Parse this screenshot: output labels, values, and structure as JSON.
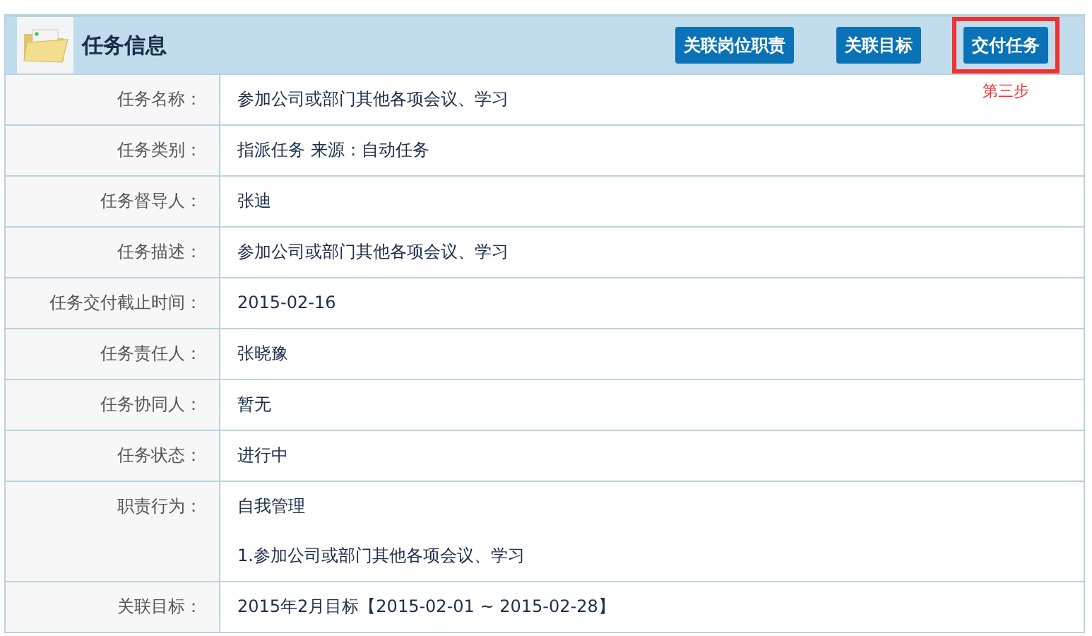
{
  "panel": {
    "title": "任务信息"
  },
  "buttons": [
    {
      "label": "关联岗位职责",
      "highlighted": false
    },
    {
      "label": "关联目标",
      "highlighted": false
    },
    {
      "label": "交付任务",
      "highlighted": true
    }
  ],
  "annotation": "第三步",
  "rows": [
    {
      "label": "任务名称：",
      "values": [
        "参加公司或部门其他各项会议、学习"
      ]
    },
    {
      "label": "任务类别：",
      "values": [
        "指派任务 来源：自动任务"
      ]
    },
    {
      "label": "任务督导人：",
      "values": [
        "张迪"
      ]
    },
    {
      "label": "任务描述：",
      "values": [
        "参加公司或部门其他各项会议、学习"
      ]
    },
    {
      "label": "任务交付截止时间：",
      "values": [
        "2015-02-16"
      ]
    },
    {
      "label": "任务责任人：",
      "values": [
        "张晓豫"
      ]
    },
    {
      "label": "任务协同人：",
      "values": [
        "暂无"
      ]
    },
    {
      "label": "任务状态：",
      "values": [
        "进行中"
      ]
    },
    {
      "label": "职责行为：",
      "values": [
        "自我管理",
        "1.参加公司或部门其他各项会议、学习"
      ]
    },
    {
      "label": "关联目标：",
      "values": [
        "2015年2月目标【2015-02-01 ~ 2015-02-28】"
      ]
    }
  ]
}
